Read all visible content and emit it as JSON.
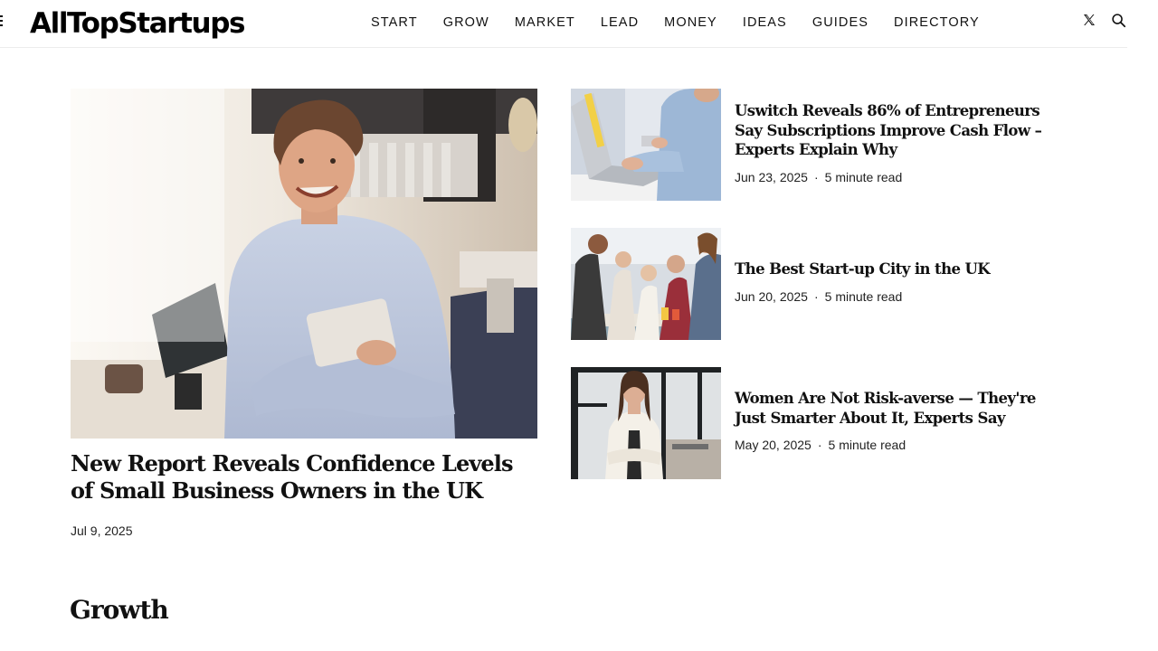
{
  "site": {
    "logo": "AllTopStartups"
  },
  "nav": {
    "items": [
      "START",
      "GROW",
      "MARKET",
      "LEAD",
      "MONEY",
      "IDEAS",
      "GUIDES",
      "DIRECTORY"
    ]
  },
  "header_icons": [
    "menu-icon",
    "x-twitter-icon",
    "search-icon"
  ],
  "featured": {
    "title": "New Report Reveals Confidence Levels of Small Business Owners in the UK",
    "date": "Jul 9, 2025",
    "image": "smiling-shop-owner-photo"
  },
  "side_articles": [
    {
      "title": "Uswitch Reveals 86% of Entrepreneurs Say Subscriptions Improve Cash Flow – Experts Explain Why",
      "date": "Jun 23, 2025",
      "read_time": "5 minute read",
      "image": "laptop-card-payment-photo"
    },
    {
      "title": "The Best Start-up City in the UK",
      "date": "Jun 20, 2025",
      "read_time": "5 minute read",
      "image": "team-meeting-photo"
    },
    {
      "title": "Women Are Not Risk-averse — They're Just Smarter About It, Experts Say",
      "date": "May 20, 2025",
      "read_time": "5 minute read",
      "image": "businesswoman-office-photo"
    }
  ],
  "meta_separator": "·",
  "sections": {
    "growth_title": "Growth"
  }
}
